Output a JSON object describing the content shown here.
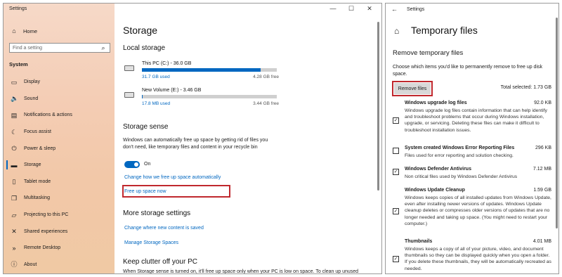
{
  "left": {
    "app_title": "Settings",
    "window_controls": [
      "—",
      "☐",
      "✕"
    ],
    "home_label": "Home",
    "search_placeholder": "Find a setting",
    "section": "System",
    "nav_items": [
      {
        "label": "Display",
        "icon": "display-icon",
        "glyph": "▭"
      },
      {
        "label": "Sound",
        "icon": "sound-icon",
        "glyph": "🔈"
      },
      {
        "label": "Notifications & actions",
        "icon": "notifications-icon",
        "glyph": "▤"
      },
      {
        "label": "Focus assist",
        "icon": "focus-assist-icon",
        "glyph": "☾"
      },
      {
        "label": "Power & sleep",
        "icon": "power-icon",
        "glyph": "⏻"
      },
      {
        "label": "Storage",
        "icon": "storage-icon",
        "glyph": "▬"
      },
      {
        "label": "Tablet mode",
        "icon": "tablet-icon",
        "glyph": "▯"
      },
      {
        "label": "Multitasking",
        "icon": "multitasking-icon",
        "glyph": "❐"
      },
      {
        "label": "Projecting to this PC",
        "icon": "projecting-icon",
        "glyph": "▱"
      },
      {
        "label": "Shared experiences",
        "icon": "shared-experiences-icon",
        "glyph": "✕"
      },
      {
        "label": "Remote Desktop",
        "icon": "remote-desktop-icon",
        "glyph": "»"
      },
      {
        "label": "About",
        "icon": "about-icon",
        "glyph": "ⓘ"
      }
    ],
    "active_nav": "Storage",
    "page_title": "Storage",
    "local_storage_heading": "Local storage",
    "drives": [
      {
        "name": "This PC (C:) - 36.0 GB",
        "used": "31.7 GB used",
        "free": "4.28 GB free",
        "used_fraction": 0.88
      },
      {
        "name": "New Volume (E:) - 3.46 GB",
        "used": "17.8 MB used",
        "free": "3.44 GB free",
        "used_fraction": 0.005
      }
    ],
    "storage_sense_heading": "Storage sense",
    "storage_sense_desc": "Windows can automatically free up space by getting rid of files you don't need, like temporary files and content in your recycle bin",
    "toggle_state": "On",
    "link_change_free": "Change how we free up space automatically",
    "link_free_now": "Free up space now",
    "more_settings_heading": "More storage settings",
    "link_change_where": "Change where new content is saved",
    "link_manage_spaces": "Manage Storage Spaces",
    "keep_clutter_heading": "Keep clutter off your PC",
    "keep_clutter_desc": "When Storage sense is turned on, it'll free up space only when your PC is low on space. To clean up unused"
  },
  "right": {
    "app_title": "Settings",
    "page_title": "Temporary files",
    "section_heading": "Remove temporary files",
    "instructions": "Choose which items you'd like to permanently remove to free up disk space.",
    "remove_button": "Remove files",
    "total_selected": "Total selected: 1.73 GB",
    "items": [
      {
        "name": "Windows upgrade log files",
        "size": "92.0 KB",
        "checked": true,
        "desc": "Windows upgrade log files contain information that can help identify and troubleshoot problems that occur during Windows installation, upgrade, or servicing.  Deleting these files can make it difficult to troubleshoot installation issues."
      },
      {
        "name": "System created Windows Error Reporting Files",
        "size": "296 KB",
        "checked": false,
        "desc": "Files used for error reporting and solution checking."
      },
      {
        "name": "Windows Defender Antivirus",
        "size": "7.12 MB",
        "checked": true,
        "desc": "Non critical files used by Windows Defender Antivirus"
      },
      {
        "name": "Windows Update Cleanup",
        "size": "1.59 GB",
        "checked": true,
        "desc": "Windows keeps copies of all installed updates from Windows Update, even after installing newer versions of updates. Windows Update cleanup deletes or compresses older versions of updates that are no longer needed and taking up space. (You might need to restart your computer.)"
      },
      {
        "name": "Thumbnails",
        "size": "4.01 MB",
        "checked": true,
        "desc": "Windows keeps a copy of all of your picture, video, and document thumbnails so they can be displayed quickly when you open a folder. If you delete these thumbnails, they will be automatically recreated as needed."
      }
    ]
  },
  "colors": {
    "accent": "#0067c0",
    "highlight": "#c0282e",
    "sidebar": "#f4cdb5"
  }
}
